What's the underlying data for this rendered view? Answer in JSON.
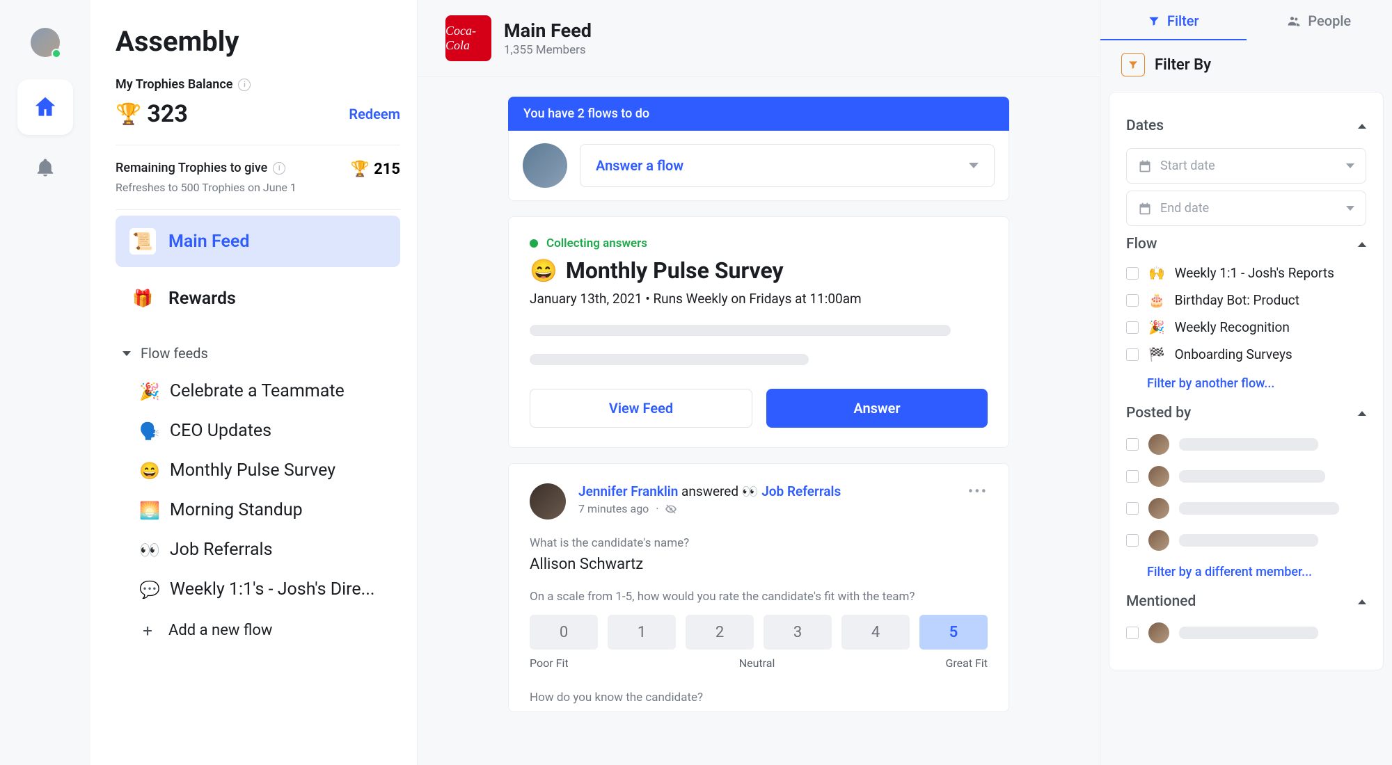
{
  "sidebar": {
    "app_name": "Assembly",
    "balance_label": "My Trophies Balance",
    "balance_value": "323",
    "redeem_label": "Redeem",
    "remaining_label": "Remaining Trophies to give",
    "remaining_value": "215",
    "refresh_note": "Refreshes to 500 Trophies on June 1",
    "main_feed_label": "Main Feed",
    "rewards_label": "Rewards",
    "flow_feeds_label": "Flow feeds",
    "flows": [
      {
        "emoji": "🎉",
        "label": "Celebrate a Teammate"
      },
      {
        "emoji": "🗣️",
        "label": "CEO Updates"
      },
      {
        "emoji": "😄",
        "label": "Monthly Pulse Survey"
      },
      {
        "emoji": "🌅",
        "label": "Morning Standup"
      },
      {
        "emoji": "👀",
        "label": "Job Referrals"
      },
      {
        "emoji": "💬",
        "label": "Weekly 1:1's - Josh's Dire..."
      }
    ],
    "add_flow_label": "Add a new flow"
  },
  "header": {
    "brand_text": "Coca-Cola",
    "title": "Main Feed",
    "members": "1,355 Members"
  },
  "todo": {
    "banner": "You have 2 flows to do",
    "answer_placeholder": "Answer a flow"
  },
  "survey_card": {
    "status": "Collecting answers",
    "emoji": "😄",
    "title": "Monthly Pulse Survey",
    "meta": "January 13th, 2021 • Runs Weekly on Fridays at 11:00am",
    "view_feed": "View Feed",
    "answer": "Answer"
  },
  "post": {
    "author": "Jennifer Franklin",
    "verb": " answered ",
    "flow_emoji": "👀",
    "flow_name": "Job Referrals",
    "time": "7 minutes ago",
    "q1_label": "What is the candidate's name?",
    "q1_answer": "Allison Schwartz",
    "q2_label": "On a scale from 1-5, how would you rate the candidate's fit with the team?",
    "scale": [
      "0",
      "1",
      "2",
      "3",
      "4",
      "5"
    ],
    "selected_index": 5,
    "scale_low": "Poor Fit",
    "scale_mid": "Neutral",
    "scale_high": "Great Fit",
    "q3_label": "How do you know the candidate?"
  },
  "filter": {
    "tab_filter": "Filter",
    "tab_people": "People",
    "filter_by": "Filter By",
    "dates_label": "Dates",
    "start_date": "Start date",
    "end_date": "End date",
    "flow_label": "Flow",
    "flows": [
      {
        "emoji": "🙌",
        "label": "Weekly 1:1 - Josh's Reports"
      },
      {
        "emoji": "🎂",
        "label": "Birthday Bot: Product"
      },
      {
        "emoji": "🎉",
        "label": "Weekly Recognition"
      },
      {
        "emoji": "🏁",
        "label": "Onboarding Surveys"
      }
    ],
    "filter_another_flow": "Filter by another flow...",
    "posted_by_label": "Posted by",
    "filter_member": "Filter by a different member...",
    "mentioned_label": "Mentioned"
  }
}
